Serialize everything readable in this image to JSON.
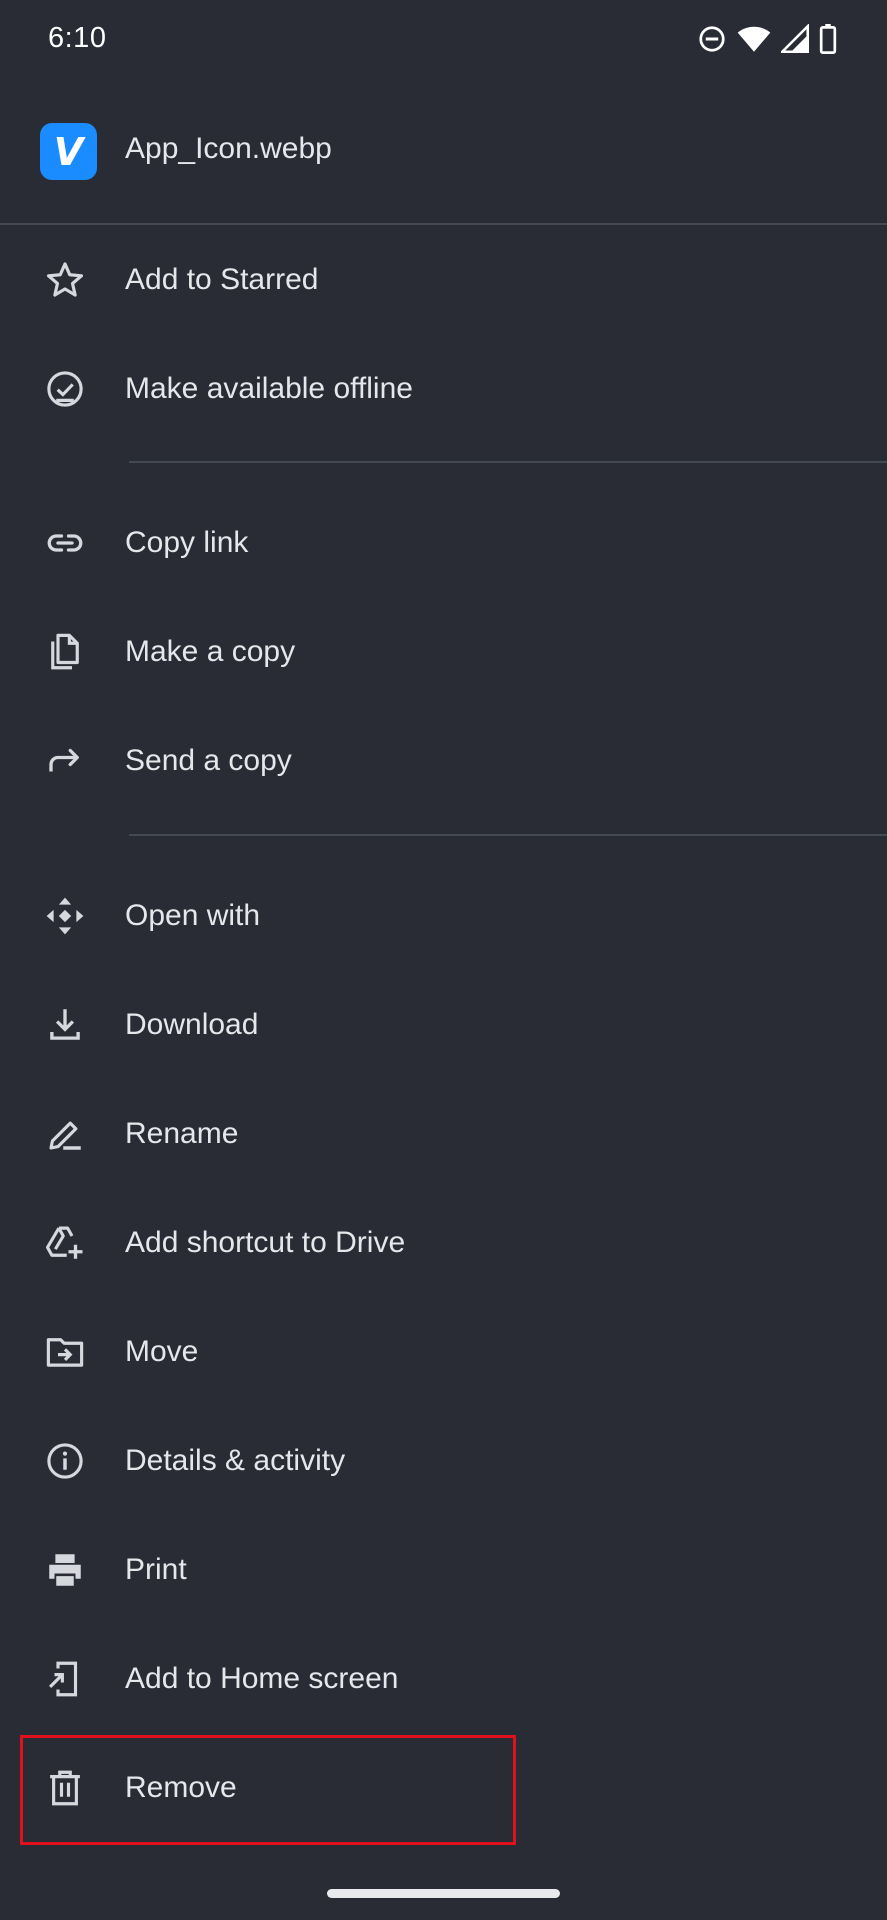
{
  "status_bar": {
    "time": "6:10",
    "icons": [
      "do-not-disturb-icon",
      "wifi-icon",
      "signal-icon",
      "battery-icon"
    ]
  },
  "file": {
    "name": "App_Icon.webp",
    "app_icon_letter": "V",
    "app_icon_color": "#1a8cff"
  },
  "menu": {
    "add_to_starred": "Add to Starred",
    "make_available_offline": "Make available offline",
    "copy_link": "Copy link",
    "make_a_copy": "Make a copy",
    "send_a_copy": "Send a copy",
    "open_with": "Open with",
    "download": "Download",
    "rename": "Rename",
    "add_shortcut_to_drive": "Add shortcut to Drive",
    "move": "Move",
    "details_activity": "Details & activity",
    "print": "Print",
    "add_to_home_screen": "Add to Home screen",
    "remove": "Remove"
  },
  "highlight_color": "#e0101c"
}
